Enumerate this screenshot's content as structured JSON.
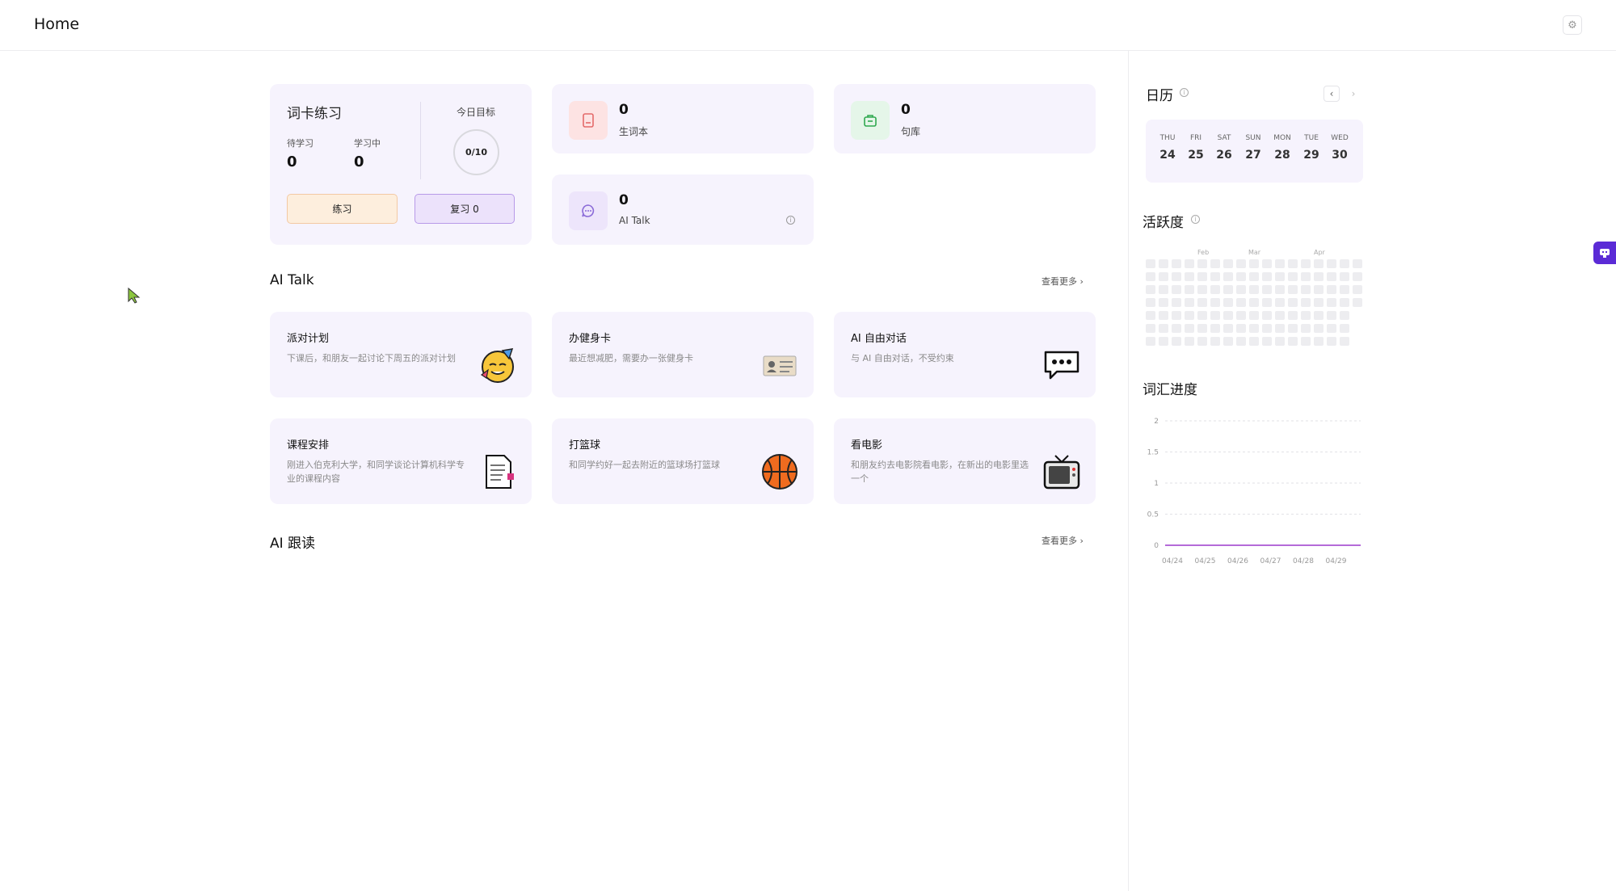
{
  "header": {
    "title": "Home",
    "settings_icon": "gear-icon"
  },
  "practice": {
    "title": "词卡练习",
    "to_learn_label": "待学习",
    "to_learn_value": "0",
    "learning_label": "学习中",
    "learning_value": "0",
    "goal_label": "今日目标",
    "goal_value": "0/10",
    "practice_button": "练习",
    "review_button": "复习 0"
  },
  "stats": {
    "vocab": {
      "value": "0",
      "label": "生词本",
      "icon": "book-icon",
      "color": "#e46a6a"
    },
    "sentences": {
      "value": "0",
      "label": "句库",
      "icon": "briefcase-icon",
      "color": "#2fa84f"
    },
    "ai_talk": {
      "value": "0",
      "label": "AI Talk",
      "icon": "chat-bubble-icon",
      "color": "#8b6bd8"
    }
  },
  "ai_talk_section": {
    "title": "AI Talk",
    "more": "查看更多",
    "cards": [
      {
        "title": "派对计划",
        "desc": "下课后，和朋友一起讨论下周五的派对计划",
        "icon": "party-face-icon"
      },
      {
        "title": "办健身卡",
        "desc": "最近想减肥，需要办一张健身卡",
        "icon": "id-card-icon"
      },
      {
        "title": "AI 自由对话",
        "desc": "与 AI 自由对话，不受约束",
        "icon": "speech-balloon-icon"
      },
      {
        "title": "课程安排",
        "desc": "刚进入伯克利大学，和同学谈论计算机科学专业的课程内容",
        "icon": "document-icon"
      },
      {
        "title": "打篮球",
        "desc": "和同学约好一起去附近的篮球场打篮球",
        "icon": "basketball-icon"
      },
      {
        "title": "看电影",
        "desc": "和朋友约去电影院看电影，在新出的电影里选一个",
        "icon": "television-icon"
      }
    ]
  },
  "ai_follow_section": {
    "title": "AI 跟读",
    "more": "查看更多"
  },
  "calendar": {
    "title": "日历",
    "days": [
      {
        "dow": "THU",
        "num": "24"
      },
      {
        "dow": "FRI",
        "num": "25"
      },
      {
        "dow": "SAT",
        "num": "26"
      },
      {
        "dow": "SUN",
        "num": "27"
      },
      {
        "dow": "MON",
        "num": "28"
      },
      {
        "dow": "TUE",
        "num": "29"
      },
      {
        "dow": "WED",
        "num": "30"
      }
    ]
  },
  "activity": {
    "title": "活跃度",
    "months": [
      "Feb",
      "Mar",
      "Apr"
    ]
  },
  "vocab_progress": {
    "title": "词汇进度",
    "chart_data": {
      "type": "line",
      "x": [
        "04/24",
        "04/25",
        "04/26",
        "04/27",
        "04/28",
        "04/29"
      ],
      "series": [
        {
          "values": [
            0,
            0,
            0,
            0,
            0,
            0
          ]
        }
      ],
      "y_ticks": [
        "2",
        "1.5",
        "1",
        "0.5",
        "0"
      ],
      "ylim": [
        0,
        2
      ],
      "grid": true,
      "line_color": "#b46bd8"
    }
  }
}
